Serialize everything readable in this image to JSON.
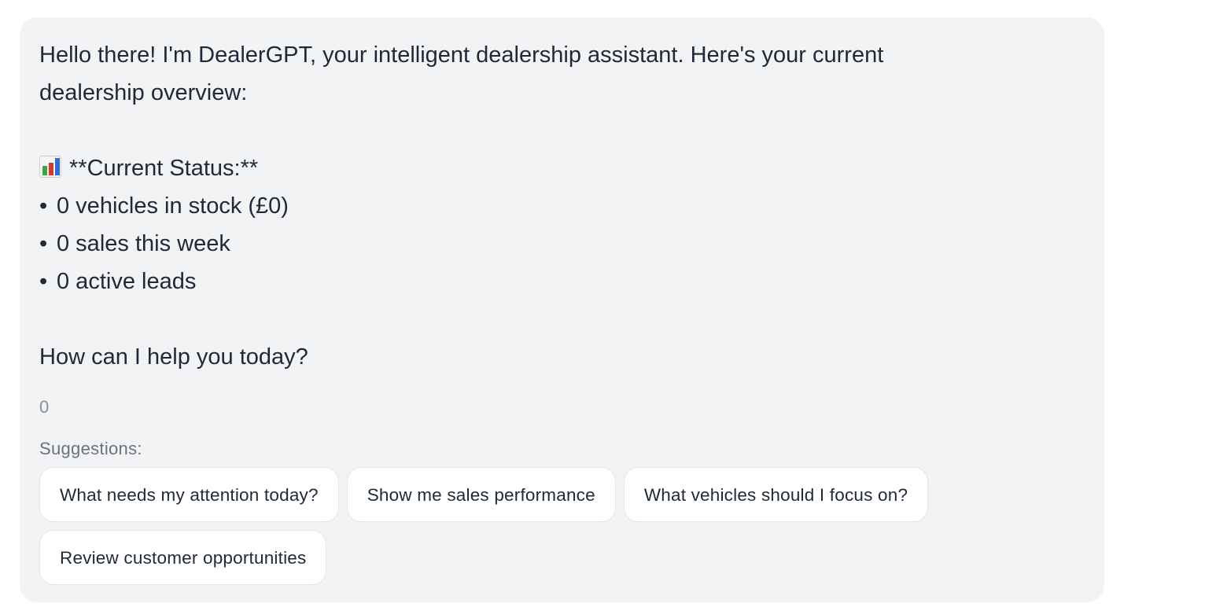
{
  "message": {
    "intro": "Hello there! I'm DealerGPT, your intelligent dealership assistant. Here's your current dealership overview:",
    "status_heading": "**Current Status:**",
    "bullets": [
      "0 vehicles in stock (£0)",
      "0 sales this week",
      "0 active leads"
    ],
    "bullet_char": "•",
    "question": "How can I help you today?",
    "count": "0"
  },
  "suggestions": {
    "label": "Suggestions:",
    "items": [
      "What needs my attention today?",
      "Show me sales performance",
      "What vehicles should I focus on?",
      "Review customer opportunities"
    ]
  },
  "icons": {
    "status_icon": "bar-chart-icon"
  }
}
